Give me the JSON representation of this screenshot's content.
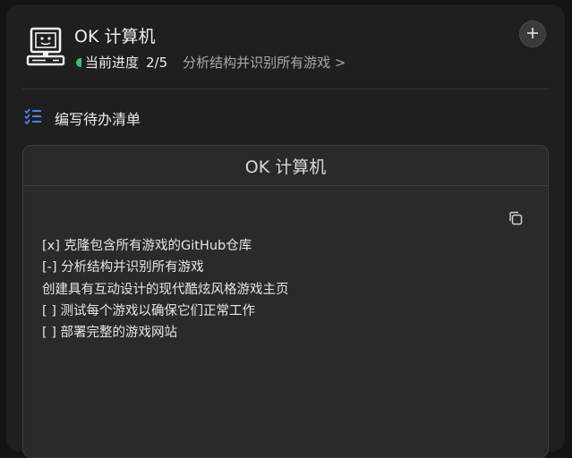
{
  "app": {
    "title": "OK 计算机",
    "icon": "retro-computer-icon"
  },
  "progress": {
    "label": "当前进度",
    "step": "2/5",
    "current_task": "分析结构并识别所有游戏 >",
    "status_color": "#33c76a"
  },
  "header": {
    "add_button_icon": "plus-icon"
  },
  "section": {
    "icon": "checklist-icon",
    "title": "编写待办清单",
    "accent_color": "#4e8cff"
  },
  "card": {
    "title": "OK 计算机",
    "copy_icon": "copy-icon",
    "todos": [
      "[x] 克隆包含所有游戏的GitHub仓库",
      "[-] 分析结构并识别所有游戏",
      "创建具有互动设计的现代酷炫风格游戏主页",
      "[ ] 测试每个游戏以确保它们正常工作",
      "[ ] 部署完整的游戏网站"
    ]
  }
}
